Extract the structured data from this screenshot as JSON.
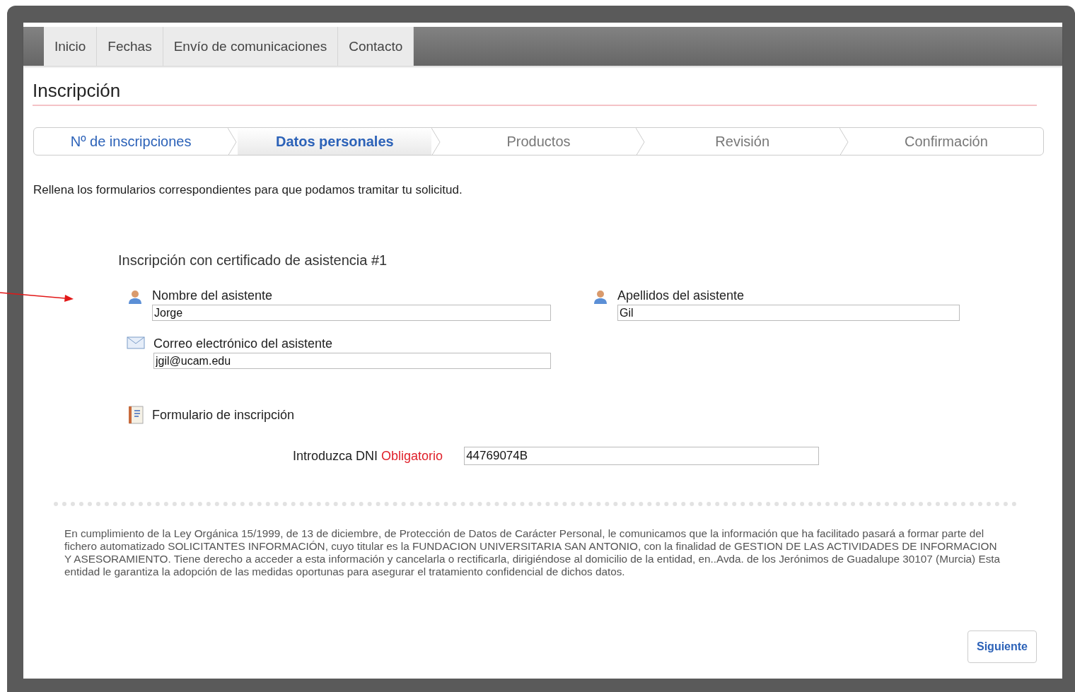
{
  "nav": {
    "tabs": [
      {
        "label": "Inicio",
        "selected": false
      },
      {
        "label": "Fechas",
        "selected": false
      },
      {
        "label": "Envío de comunicaciones",
        "selected": false
      },
      {
        "label": "Contacto",
        "selected": false
      }
    ]
  },
  "page_title": "Inscripción",
  "steps": [
    {
      "label": "Nº de inscripciones",
      "selected": false,
      "done": true
    },
    {
      "label": "Datos personales",
      "selected": true,
      "done": false
    },
    {
      "label": "Productos",
      "selected": false,
      "done": false
    },
    {
      "label": "Revisión",
      "selected": false,
      "done": false
    },
    {
      "label": "Confirmación",
      "selected": false,
      "done": false
    }
  ],
  "intro": "Rellena los formularios correspondientes para que podamos tramitar tu solicitud.",
  "form": {
    "title": "Inscripción con certificado de asistencia #1",
    "fields": [
      {
        "kind": "person",
        "label": "Nombre del asistente",
        "value": "Jorge"
      },
      {
        "kind": "person",
        "label": "Apellidos del asistente",
        "value": "Gil"
      },
      {
        "kind": "mail",
        "label": "Correo electrónico del asistente",
        "value": "jgil@ucam.edu"
      }
    ],
    "section": "Formulario de inscripción",
    "dni": {
      "label": "Introduzca DNI",
      "required": "Obligatorio",
      "value": "44769074B"
    }
  },
  "legal": "En cumplimiento de la Ley Orgánica 15/1999, de 13 de diciembre, de Protección de Datos de Carácter Personal, le comunicamos que la información que ha facilitado pasará a formar parte del fichero automatizado SOLICITANTES INFORMACIÓN, cuyo titular es la FUNDACION UNIVERSITARIA SAN ANTONIO, con la finalidad de GESTION DE LAS ACTIVIDADES DE INFORMACION Y ASESORAMIENTO. Tiene derecho a acceder a esta información y cancelarla o rectificarla, dirigiéndose al domicilio de la entidad, en..Avda. de los Jerónimos de Guadalupe 30107 (Murcia) Esta entidad le garantiza la adopción de las medidas oportunas para asegurar el tratamiento confidencial de dichos datos.",
  "next_button": "Siguiente"
}
